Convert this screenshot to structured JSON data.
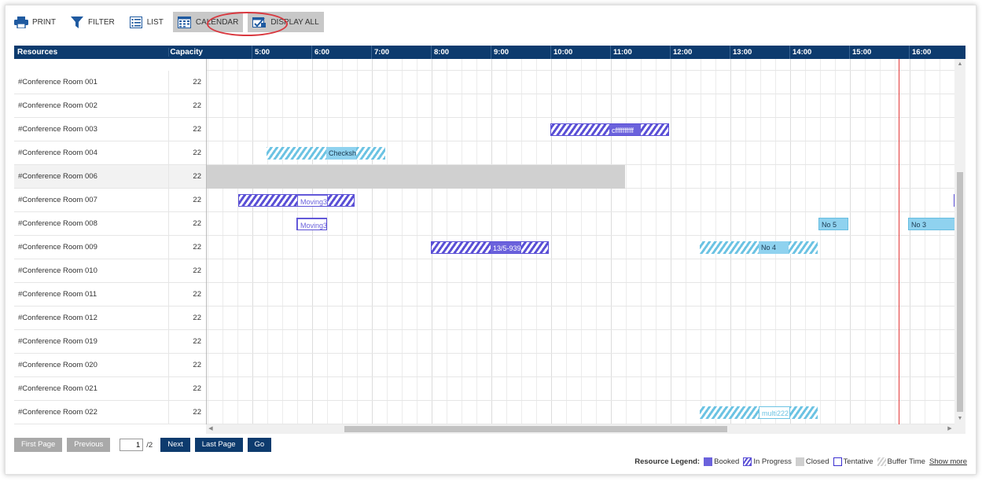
{
  "toolbar": {
    "print": "PRINT",
    "filter": "FILTER",
    "list": "LIST",
    "calendar": "CALENDAR",
    "display_all": "DISPLAY ALL"
  },
  "grid": {
    "resources_header": "Resources",
    "capacity_header": "Capacity",
    "hours": [
      "5:00",
      "6:00",
      "7:00",
      "8:00",
      "9:00",
      "10:00",
      "11:00",
      "12:00",
      "13:00",
      "14:00",
      "15:00",
      "16:00"
    ],
    "rows": [
      {
        "name": "#Conference Room 001",
        "capacity": "22"
      },
      {
        "name": "#Conference Room 002",
        "capacity": "22"
      },
      {
        "name": "#Conference Room 003",
        "capacity": "22"
      },
      {
        "name": "#Conference Room 004",
        "capacity": "22"
      },
      {
        "name": "#Conference Room 006",
        "capacity": "22"
      },
      {
        "name": "#Conference Room 007",
        "capacity": "22"
      },
      {
        "name": "#Conference Room 008",
        "capacity": "22"
      },
      {
        "name": "#Conference Room 009",
        "capacity": "22"
      },
      {
        "name": "#Conference Room 010",
        "capacity": "22"
      },
      {
        "name": "#Conference Room 011",
        "capacity": "22"
      },
      {
        "name": "#Conference Room 012",
        "capacity": "22"
      },
      {
        "name": "#Conference Room 019",
        "capacity": "22"
      },
      {
        "name": "#Conference Room 020",
        "capacity": "22"
      },
      {
        "name": "#Conference Room 021",
        "capacity": "22"
      },
      {
        "name": "#Conference Room 022",
        "capacity": "22"
      }
    ],
    "events": {
      "room003": "cffffffffff",
      "room004": "Checksh",
      "room007": "Moving3",
      "room008a": "Moving3",
      "room008b": "No 5",
      "room008c": "No 3",
      "room009a": "13/5-939",
      "room009b": "No 4",
      "room022": "multi222"
    }
  },
  "pager": {
    "first": "First Page",
    "previous": "Previous",
    "current": "1",
    "total": "/2",
    "next": "Next",
    "last": "Last Page",
    "go": "Go"
  },
  "legend": {
    "title": "Resource Legend:",
    "booked": "Booked",
    "in_progress": "In Progress",
    "closed": "Closed",
    "tentative": "Tentative",
    "buffer": "Buffer Time",
    "show_more": "Show more"
  },
  "colors": {
    "header": "#0d3b6e",
    "booked": "#6b62dc",
    "buffer_cyan": "#6cc3e3",
    "now_line": "#e23b3b"
  }
}
